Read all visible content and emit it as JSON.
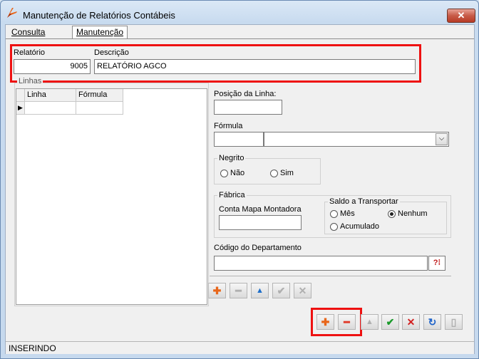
{
  "window": {
    "title": "Manutenção de Relatórios Contábeis",
    "close_glyph": "✕"
  },
  "tabs": [
    {
      "label": "Consulta"
    },
    {
      "label": "Manutenção"
    }
  ],
  "header": {
    "relatorio_label": "Relatório",
    "relatorio_value": "9005",
    "descricao_label": "Descrição",
    "descricao_value": "RELATÓRIO AGCO"
  },
  "linhas": {
    "group_title": "Linhas",
    "columns": [
      "Linha",
      "Fórmula"
    ],
    "row_indicator": "▶"
  },
  "form": {
    "posicao_label": "Posição da Linha:",
    "posicao_value": "",
    "formula_label": "Fórmula",
    "formula_code_value": "",
    "formula_select_value": "",
    "negrito_title": "Negrito",
    "negrito_options": [
      "Não",
      "Sim"
    ],
    "fabrica_title": "Fábrica",
    "conta_label": "Conta Mapa Montadora",
    "conta_value": "",
    "saldo_title": "Saldo a Transportar",
    "saldo_options": [
      "Mês",
      "Nenhum",
      "Acumulado"
    ],
    "saldo_selected": "Nenhum",
    "depto_label": "Código do Departamento",
    "depto_value": "",
    "lookup_glyph": "?⁞"
  },
  "inner_toolbar": [
    "✚",
    "━",
    "▲",
    "✔",
    "✕"
  ],
  "main_toolbar": [
    "✚",
    "━",
    "▲",
    "✔",
    "✕",
    "↻",
    "▯"
  ],
  "status": {
    "text": "INSERINDO"
  },
  "colors": {
    "add": "#e8661a",
    "remove": "#e03b2a",
    "confirm": "#1a9a2a",
    "cancel": "#d21f1f",
    "refresh": "#1e63c9",
    "highlight": "#e11111"
  }
}
